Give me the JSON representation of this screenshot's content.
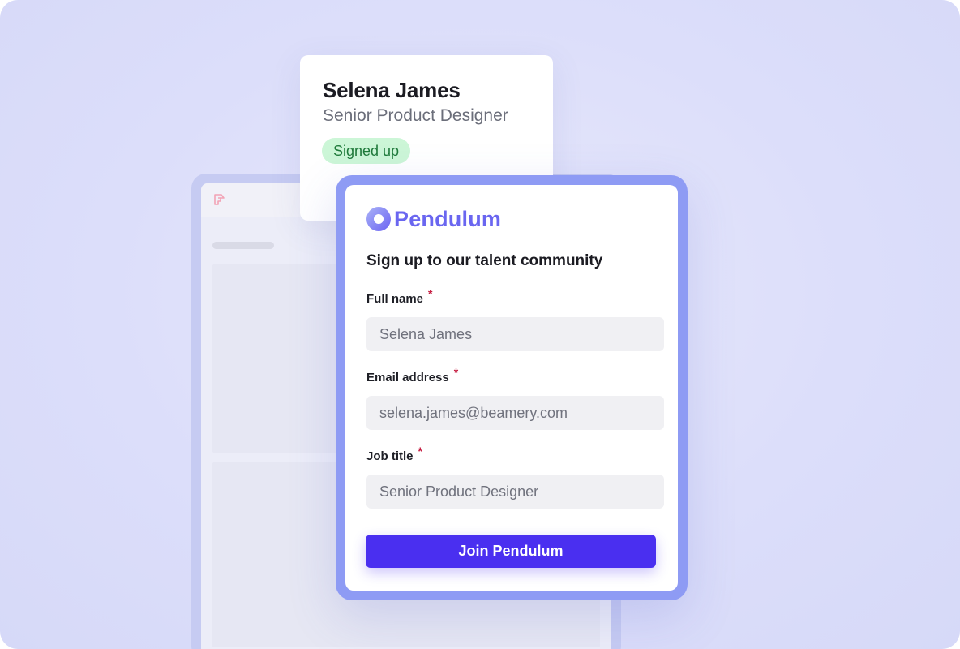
{
  "profile": {
    "name": "Selena James",
    "title": "Senior Product Designer",
    "status": "Signed up",
    "status_color": "#ccf6d7"
  },
  "brand": {
    "name": "Pendulum",
    "icon": "pendulum-logo-icon",
    "color": "#6a66f0"
  },
  "form": {
    "heading": "Sign up to our talent community",
    "fields": [
      {
        "label": "Full name",
        "required_mark": "*",
        "value": "Selena James"
      },
      {
        "label": "Email address",
        "required_mark": "*",
        "value": "selena.james@beamery.com"
      },
      {
        "label": "Job title",
        "required_mark": "*",
        "value": "Senior Product Designer"
      }
    ],
    "submit_label": "Join Pendulum",
    "submit_color": "#4a2ff0"
  },
  "background_app": {
    "logo_icon": "app-logo-icon"
  }
}
